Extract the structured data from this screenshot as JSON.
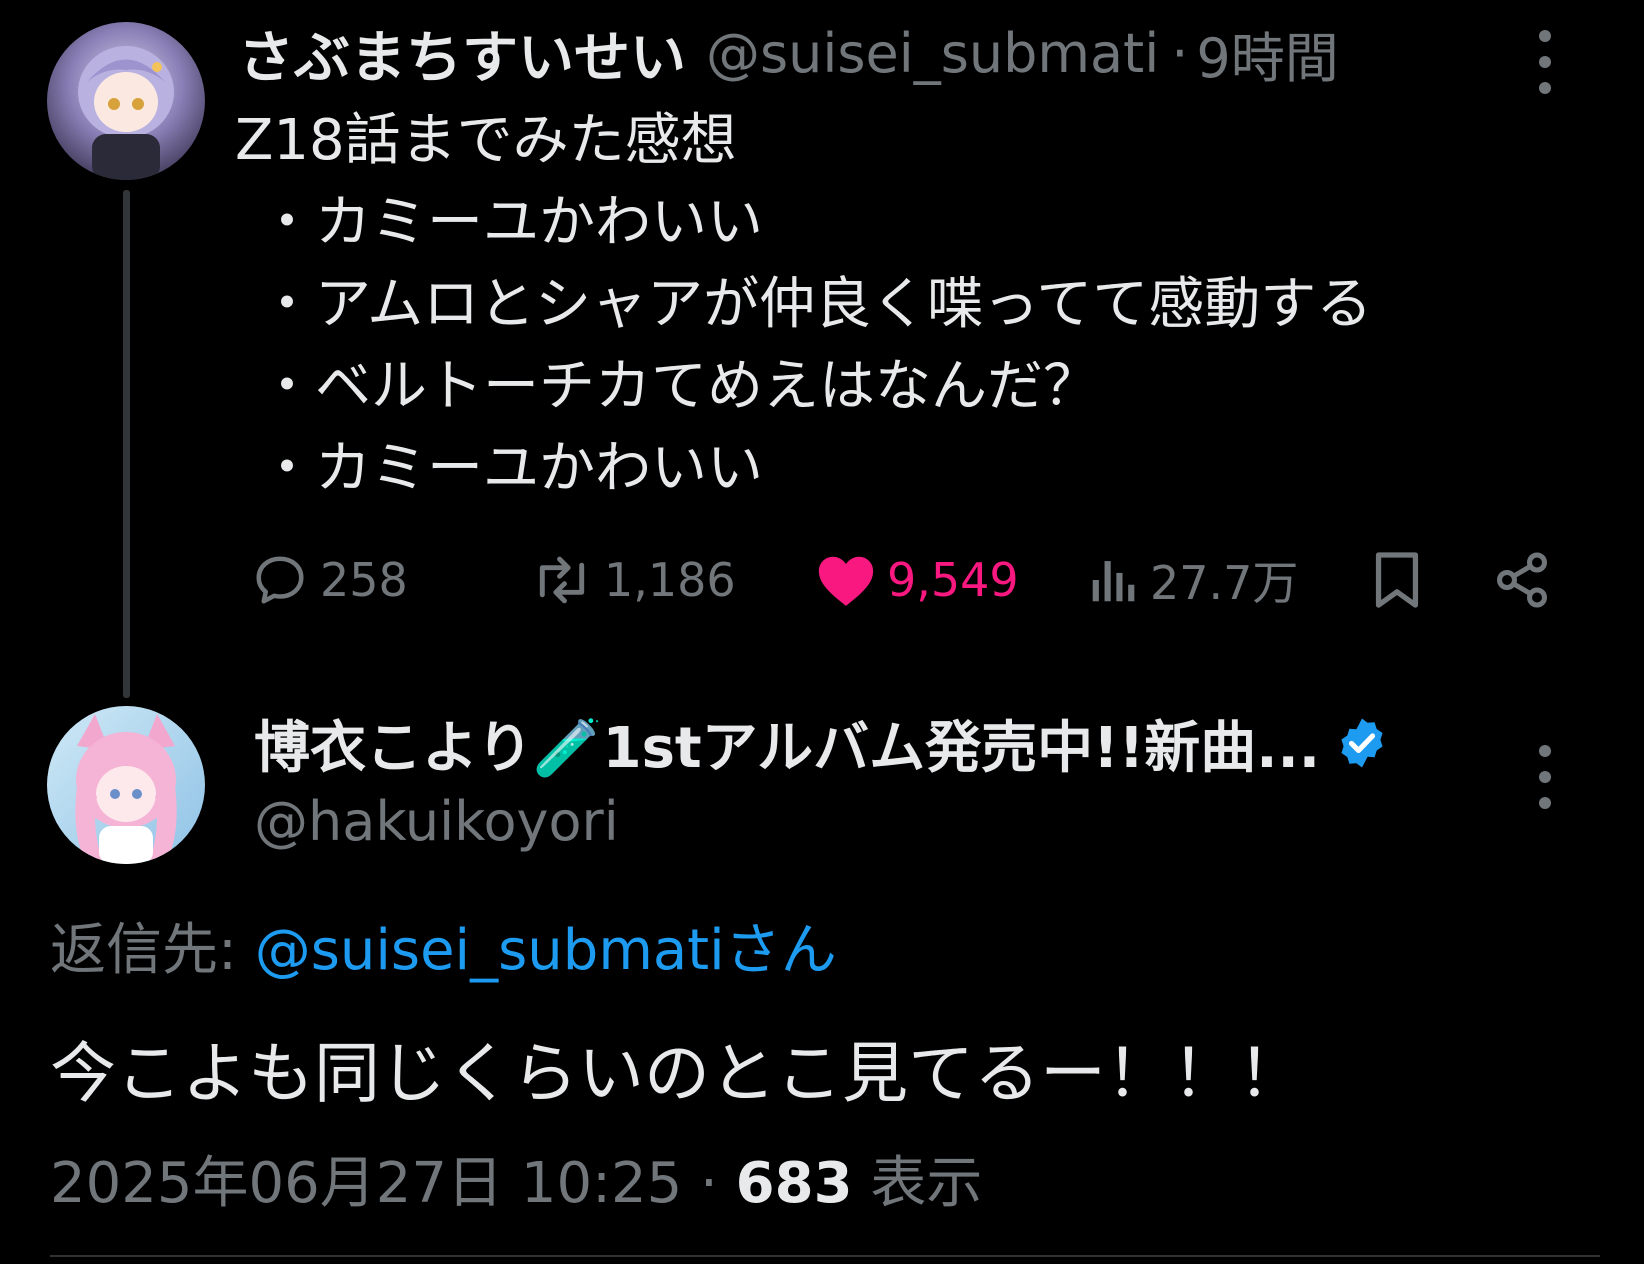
{
  "original_tweet": {
    "display_name": "さぶまちすいせい",
    "handle": "@suisei_submati",
    "time_separator": "·",
    "time_ago": "9時間",
    "text_lines": [
      "Z18話までみた感想",
      "・カミーユかわいい",
      "・アムロとシャアが仲良く喋ってて感動する",
      "・ベルトーチカてめえはなんだ？",
      "・カミーユかわいい"
    ],
    "actions": {
      "replies": "258",
      "retweets": "1,186",
      "likes": "9,549",
      "views": "27.7万"
    },
    "like_color": "#f91880",
    "avatar_icon": "avatar-image"
  },
  "reply_tweet": {
    "display_name": "博衣こより🧪1stアルバム発売中!!新曲...",
    "verified_icon": "verified-badge-icon",
    "handle": "@hakuikoyori",
    "reply_to_label": "返信先:",
    "reply_to_mention": "@suisei_submatiさん",
    "text": "今こよも同じくらいのとこ見てるー！！！",
    "date": "2025年06月27日 10:25",
    "meta_separator": "·",
    "views_count": "683",
    "views_label": "表示",
    "verified_color": "#1d9bf0"
  },
  "colors": {
    "background": "#000000",
    "primary_text": "#e7e9ea",
    "secondary_text": "#71767b",
    "accent": "#1d9bf0"
  }
}
